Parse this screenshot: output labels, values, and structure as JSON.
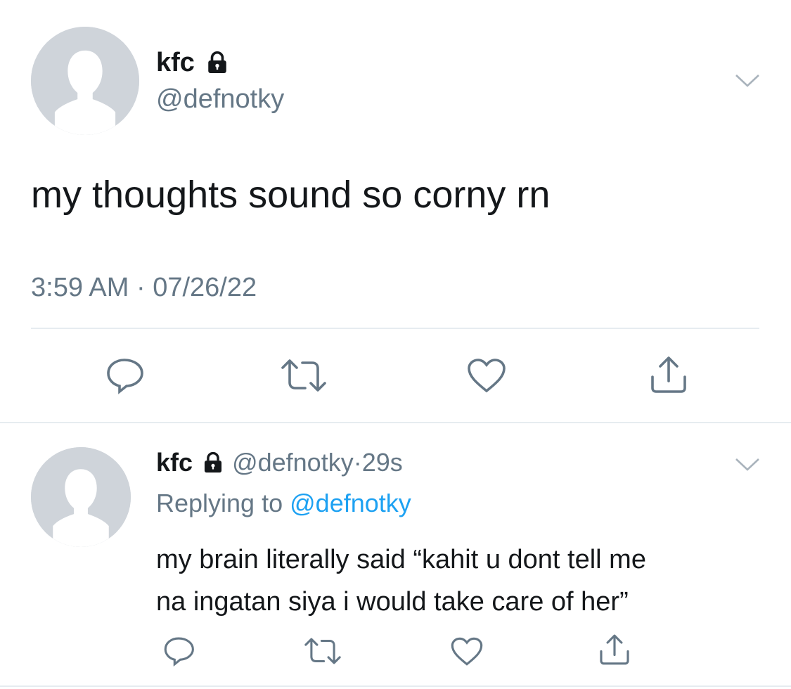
{
  "main_tweet": {
    "display_name": "kfc",
    "handle": "@defnotky",
    "text": "my thoughts sound so corny rn",
    "time": "3:59 AM",
    "separator": "·",
    "date": "07/26/22",
    "icons": {
      "protected": "lock-icon",
      "menu": "chevron-down-icon",
      "reply": "reply-icon",
      "retweet": "retweet-icon",
      "like": "heart-icon",
      "share": "share-icon"
    }
  },
  "reply_tweet": {
    "display_name": "kfc",
    "handle": "@defnotky",
    "separator": "·",
    "age": "29s",
    "replying_prefix": "Replying to",
    "replying_to": "@defnotky",
    "text_line1": "my brain literally said “kahit u dont tell me",
    "text_line2": "na ingatan siya i would take care of her”"
  },
  "colors": {
    "text": "#14171a",
    "muted": "#657786",
    "link": "#1da1f2",
    "divider": "#e6ecf0",
    "avatar": "#cfd4da"
  }
}
